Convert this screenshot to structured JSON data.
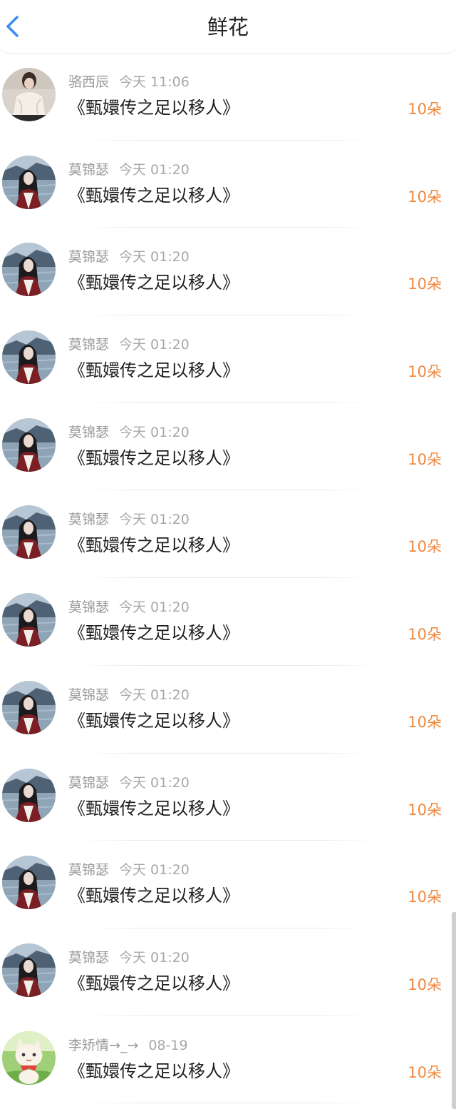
{
  "header": {
    "title": "鲜花",
    "back_icon": "chevron-left-icon",
    "back_color": "#3d8ef0"
  },
  "accent_color": "#f0873d",
  "list": [
    {
      "user": "骆西辰",
      "time": "今天 11:06",
      "book": "《甄嬛传之足以移人》",
      "count": "10朵",
      "avatar": "portrait-avatar"
    },
    {
      "user": "莫锦瑟",
      "time": "今天 01:20",
      "book": "《甄嬛传之足以移人》",
      "count": "10朵",
      "avatar": "lake-girl-avatar"
    },
    {
      "user": "莫锦瑟",
      "time": "今天 01:20",
      "book": "《甄嬛传之足以移人》",
      "count": "10朵",
      "avatar": "lake-girl-avatar"
    },
    {
      "user": "莫锦瑟",
      "time": "今天 01:20",
      "book": "《甄嬛传之足以移人》",
      "count": "10朵",
      "avatar": "lake-girl-avatar"
    },
    {
      "user": "莫锦瑟",
      "time": "今天 01:20",
      "book": "《甄嬛传之足以移人》",
      "count": "10朵",
      "avatar": "lake-girl-avatar"
    },
    {
      "user": "莫锦瑟",
      "time": "今天 01:20",
      "book": "《甄嬛传之足以移人》",
      "count": "10朵",
      "avatar": "lake-girl-avatar"
    },
    {
      "user": "莫锦瑟",
      "time": "今天 01:20",
      "book": "《甄嬛传之足以移人》",
      "count": "10朵",
      "avatar": "lake-girl-avatar"
    },
    {
      "user": "莫锦瑟",
      "time": "今天 01:20",
      "book": "《甄嬛传之足以移人》",
      "count": "10朵",
      "avatar": "lake-girl-avatar"
    },
    {
      "user": "莫锦瑟",
      "time": "今天 01:20",
      "book": "《甄嬛传之足以移人》",
      "count": "10朵",
      "avatar": "lake-girl-avatar"
    },
    {
      "user": "莫锦瑟",
      "time": "今天 01:20",
      "book": "《甄嬛传之足以移人》",
      "count": "10朵",
      "avatar": "lake-girl-avatar"
    },
    {
      "user": "莫锦瑟",
      "time": "今天 01:20",
      "book": "《甄嬛传之足以移人》",
      "count": "10朵",
      "avatar": "lake-girl-avatar"
    },
    {
      "user": "李矫情→_→",
      "time": "08-19",
      "book": "《甄嬛传之足以移人》",
      "count": "10朵",
      "avatar": "cartoon-cat-avatar"
    }
  ]
}
